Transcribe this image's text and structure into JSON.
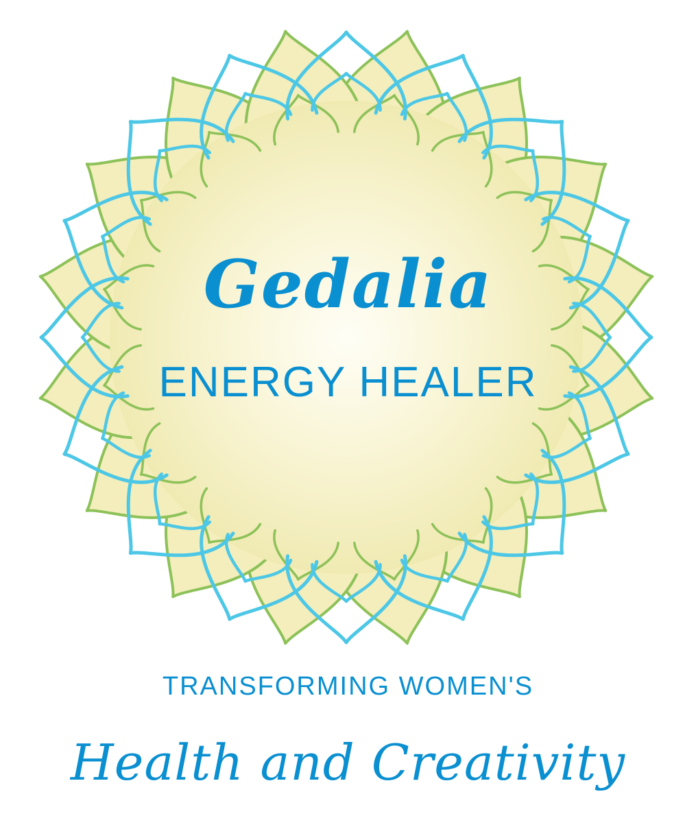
{
  "logo": {
    "brand_name": "Gedalia",
    "title": "ENERGY HEALER"
  },
  "tagline": {
    "line1": "TRANSFORMING WOMEN'S",
    "line2": "Health and Creativity"
  },
  "colors": {
    "text_blue": "#0a8fd0",
    "petal_outline_blue": "#4dc7e6",
    "petal_outline_green": "#8dc159",
    "petal_fill": "#f3eebb",
    "center_glow": "#fffef5",
    "background": "#ffffff"
  },
  "icons": {
    "emblem": "lotus-mandala-icon"
  }
}
